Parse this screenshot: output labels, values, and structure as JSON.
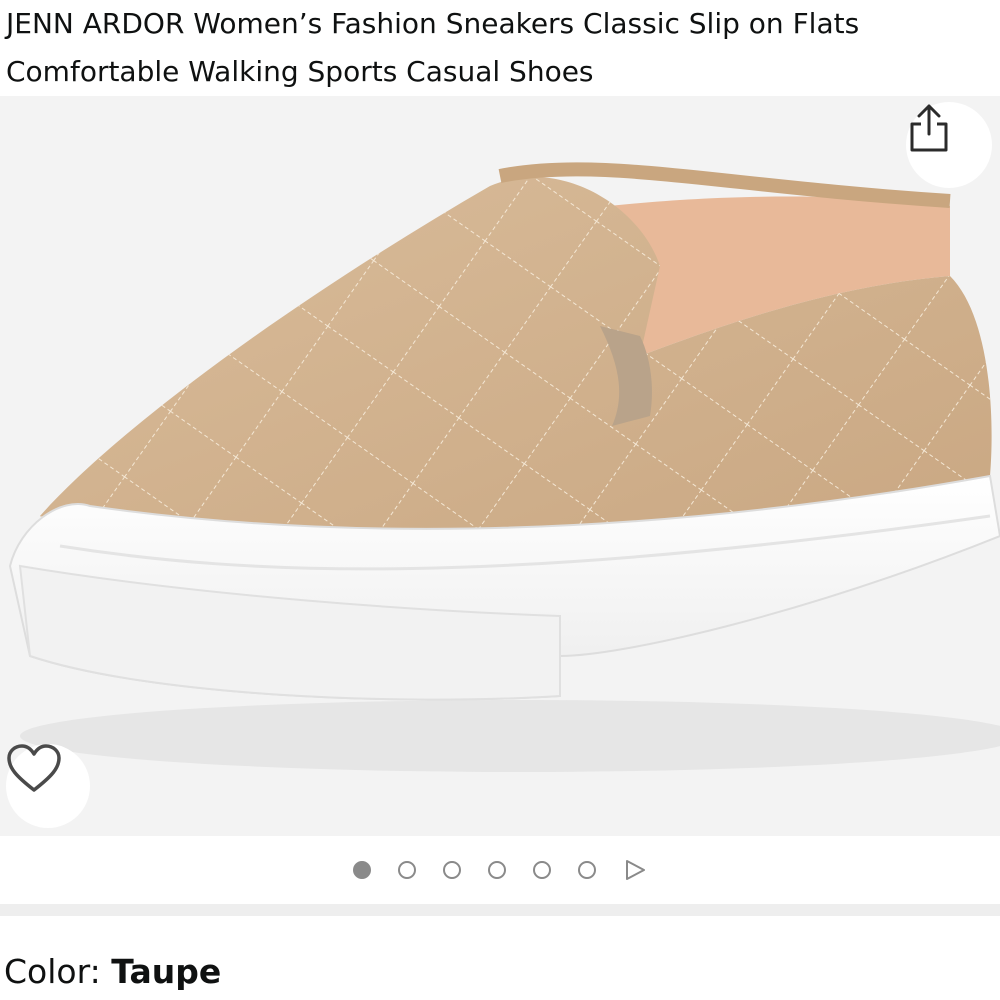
{
  "product": {
    "title": "JENN ARDOR Women’s Fashion Sneakers Classic Slip on Flats Comfortable Walking Sports Casual Shoes",
    "image_alt": "Taupe quilted slip-on sneaker with white sole"
  },
  "gallery": {
    "image_count": 6,
    "active_index": 0,
    "colors": {
      "background": "#f3f3f3",
      "upper": "#d2b28f",
      "sole": "#ffffff",
      "stitch": "#f4e7d4"
    }
  },
  "icons": {
    "share": "share-icon",
    "favorite": "heart-icon",
    "next": "play-triangle-icon"
  },
  "variation": {
    "label": "Color: ",
    "value": "Taupe"
  }
}
